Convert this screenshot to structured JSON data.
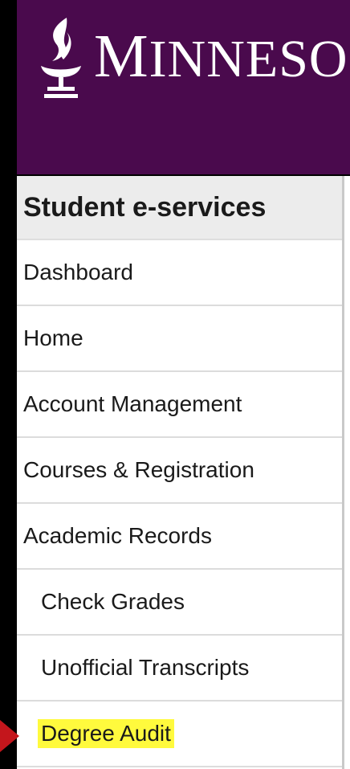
{
  "header": {
    "logo_text_first": "M",
    "logo_text_rest": "INNESO",
    "logo_icon": "flame-lamp-icon",
    "background_color": "#4a0a4d"
  },
  "sidebar": {
    "title": "Student e-services",
    "items": [
      {
        "label": "Dashboard",
        "level": 0
      },
      {
        "label": "Home",
        "level": 0
      },
      {
        "label": "Account Management",
        "level": 0
      },
      {
        "label": "Courses & Registration",
        "level": 0
      },
      {
        "label": "Academic Records",
        "level": 0
      },
      {
        "label": "Check Grades",
        "level": 1
      },
      {
        "label": "Unofficial Transcripts",
        "level": 1
      },
      {
        "label": "Degree Audit",
        "level": 1,
        "highlighted": true
      }
    ]
  },
  "annotation": {
    "arrow_color": "#c4161c",
    "highlight_color": "#fffa3d",
    "pointer_icon": "red-arrow-icon"
  }
}
